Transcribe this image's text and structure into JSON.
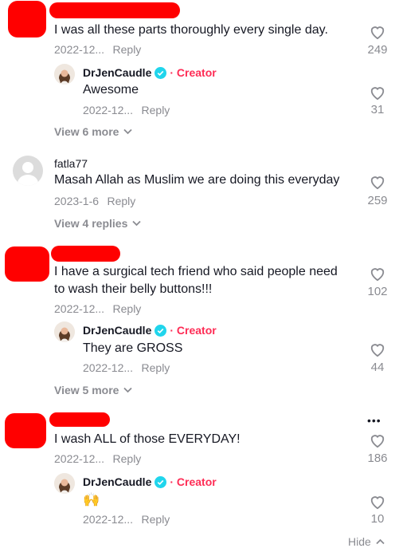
{
  "comments": [
    {
      "text": "I was all these parts thoroughly every single day.",
      "date": "2022-12...",
      "reply_label": "Reply",
      "likes": "249",
      "creator_reply": {
        "username": "DrJenCaudle",
        "badge": "· Creator",
        "text": "Awesome",
        "date": "2022-12...",
        "reply_label": "Reply",
        "likes": "31"
      },
      "view_more": "View 6 more"
    },
    {
      "username": "fatla77",
      "text": "Masah Allah as Muslim we are doing this everyday",
      "date": "2023-1-6",
      "reply_label": "Reply",
      "likes": "259",
      "view_more": "View 4 replies"
    },
    {
      "text_line1": "I have a surgical tech friend who said people need",
      "text_line2": "to wash their belly buttons!!!",
      "date": "2022-12...",
      "reply_label": "Reply",
      "likes": "102",
      "creator_reply": {
        "username": "DrJenCaudle",
        "badge": "· Creator",
        "text": "They are GROSS",
        "date": "2022-12...",
        "reply_label": "Reply",
        "likes": "44"
      },
      "view_more": "View 5 more"
    },
    {
      "text": "I wash ALL of those EVERYDAY!",
      "date": "2022-12...",
      "reply_label": "Reply",
      "likes": "186",
      "creator_reply": {
        "username": "DrJenCaudle",
        "badge": "· Creator",
        "emoji": "🙌",
        "date": "2022-12...",
        "reply_label": "Reply",
        "likes": "10"
      },
      "hide_label": "Hide"
    }
  ],
  "more_menu": "•••",
  "colors": {
    "creator": "#fe2c55",
    "verified": "#20d5ec",
    "redaction": "#ff0000",
    "muted": "#8a8b91"
  }
}
